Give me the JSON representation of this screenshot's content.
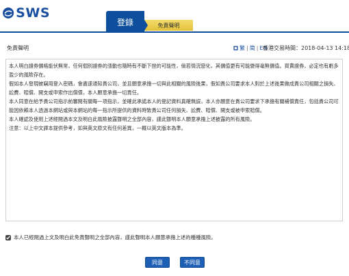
{
  "brand": {
    "logo_text": "SWS",
    "logo_color": "#1a4fa0"
  },
  "tabs": {
    "login": "登錄",
    "disclaimer": "免責聲明"
  },
  "colors": {
    "primary": "#0d4f9c",
    "tab_gold": "#e8c94a",
    "button": "#1c5fb4"
  },
  "subheader": {
    "title": "免責聲明",
    "lang_simplified": "简",
    "lang_traditional": "繁",
    "lang_english": "EN",
    "hk_time_label": "香港交易時間：",
    "hk_time_value": "2018-04-13 14:18:29"
  },
  "disclaimer": {
    "paragraphs": [
      "本人明白證券價格能伏無常，任何個別證券的漲動也隨時有不斷下挫的可能性，倘若情況惡化，其價值更有可能變得毫無價值。買賣證券，必定也有虧多盈少的風險存在。",
      "假如本人發現被竊用登入密碼，會盡速通知貴公司，並且願意承擔一切與此相關的風險後果，假如貴公司要求本人對於上述後果做成貴公司相關之損失、訟費、賠償、開支或申索作出償債，本人願意承擔一切責任。",
      "本人同意在給予貴公司指示前審閱有關每一項指示，並確此承諾本人的登記資料真確無誤，本人亦願意在貴公司要求下承擔有關補償責任，包括貴公司可能因依賴本人透過本網站或與本網站的每一指示所提供的資料時致貴公司任何損失、訟費、賠償、開支或被申索賠償。",
      "本人確認及使用上述經閱過本文及明白此風險披露聲明之全部內容，謹此聲明本人願意承擔上述披露的所有風險。",
      "注意：以上中文譯本提供參考，如與英文原文有任何差異，一概以英文版本為準。"
    ]
  },
  "agree_checkbox": {
    "checked": true,
    "label": "本人已經閱過上文及明白此免責聲明之全部內容，謹此聲明本人願意承擔上述的種種風險。"
  },
  "buttons": {
    "agree": "同意",
    "disagree": "不同意"
  }
}
